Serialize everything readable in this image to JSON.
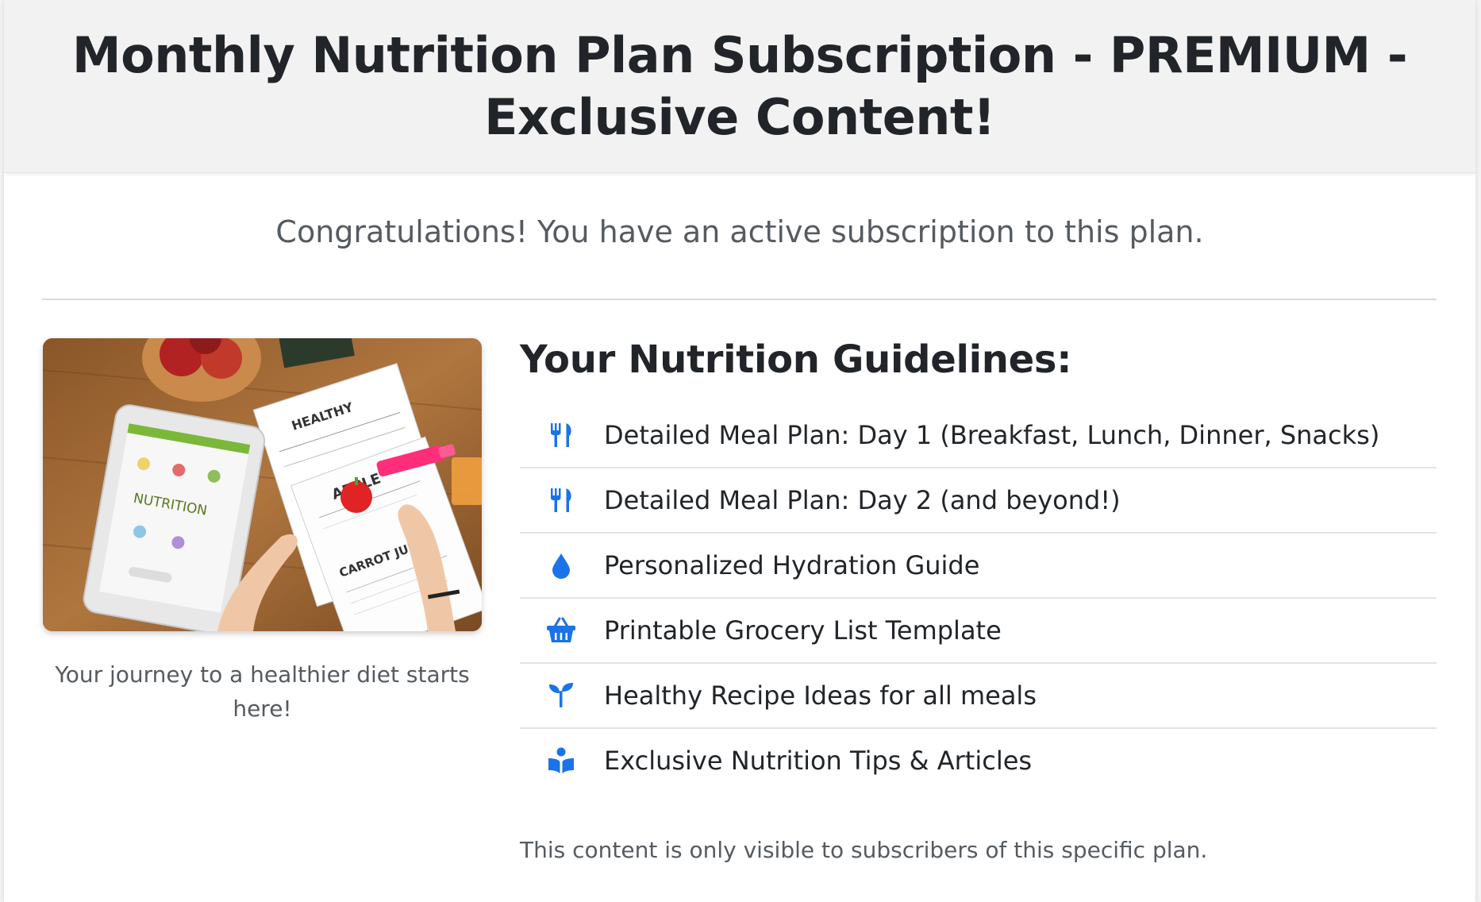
{
  "header": {
    "title": "Monthly Nutrition Plan Subscription - PREMIUM - Exclusive Content!"
  },
  "status_message": "Congratulations! You have an active subscription to this plan.",
  "image": {
    "caption": "Your journey to a healthier diet starts here!",
    "text_healthy": "HEALTHY",
    "text_apple": "APPLE",
    "text_carrot": "CARROT JUICE",
    "text_nutrition": "NUTRITION"
  },
  "guidelines": {
    "heading": "Your Nutrition Guidelines:",
    "items": [
      {
        "icon": "utensils-icon",
        "label": "Detailed Meal Plan: Day 1 (Breakfast, Lunch, Dinner, Snacks)"
      },
      {
        "icon": "utensils-icon",
        "label": "Detailed Meal Plan: Day 2 (and beyond!)"
      },
      {
        "icon": "water-drop-icon",
        "label": "Personalized Hydration Guide"
      },
      {
        "icon": "shopping-basket-icon",
        "label": "Printable Grocery List Template"
      },
      {
        "icon": "seedling-icon",
        "label": "Healthy Recipe Ideas for all meals"
      },
      {
        "icon": "book-reader-icon",
        "label": "Exclusive Nutrition Tips & Articles"
      }
    ]
  },
  "footer_note": "This content is only visible to subscribers of this specific plan.",
  "colors": {
    "accent": "#1a73e8",
    "text": "#212529",
    "muted": "#555b61",
    "header_bg": "#f2f2f2"
  }
}
